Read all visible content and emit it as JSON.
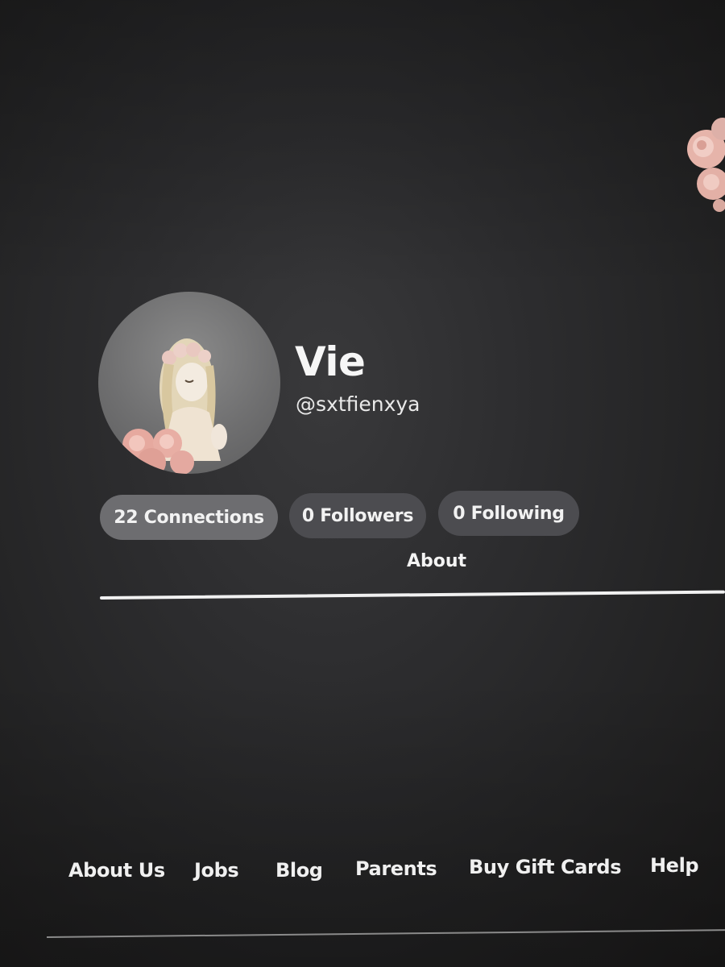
{
  "profile": {
    "display_name": "Vie",
    "username": "@sxtfienxya"
  },
  "stats": {
    "connections": "22 Connections",
    "followers": "0 Followers",
    "following": "0 Following"
  },
  "tabs": {
    "about": "About"
  },
  "footer": {
    "links": [
      "About Us",
      "Jobs",
      "Blog",
      "Parents",
      "Buy Gift Cards",
      "Help"
    ]
  },
  "colors": {
    "background": "#2b2b2d",
    "pill_active": "#6d6d70",
    "pill_inactive": "#4c4c50",
    "text": "#f4f4f4",
    "rose": "#e8b7ae"
  },
  "icons": {
    "avatar": "avatar-rose-girl",
    "decoration": "rose-cluster-decoration"
  }
}
